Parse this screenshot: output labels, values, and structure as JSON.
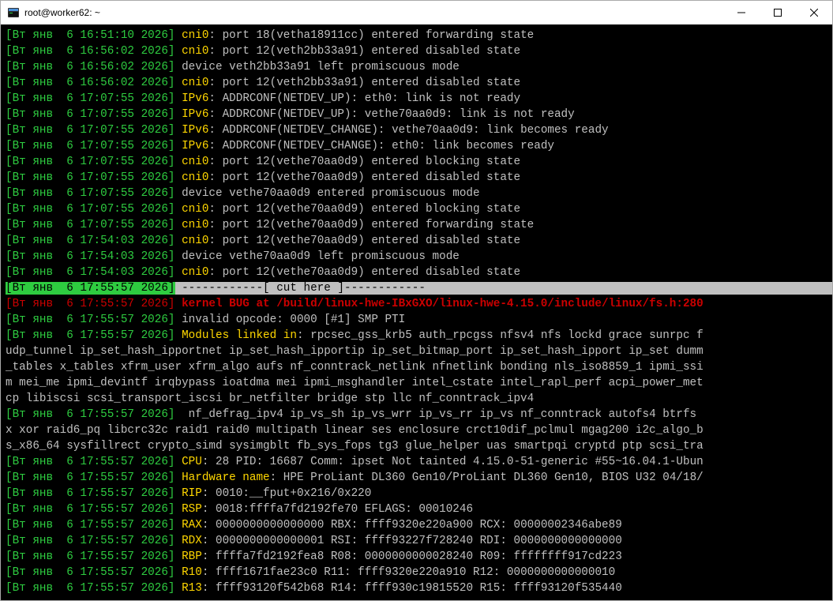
{
  "window": {
    "title": "root@worker62: ~"
  },
  "lines": [
    {
      "kind": "log",
      "ts": "[Вт янв  6 16:51:10 2026]",
      "src": "cni0",
      "msg": ": port 18(vetha18911cc) entered forwarding state"
    },
    {
      "kind": "log",
      "ts": "[Вт янв  6 16:56:02 2026]",
      "src": "cni0",
      "msg": ": port 12(veth2bb33a91) entered disabled state"
    },
    {
      "kind": "log",
      "ts": "[Вт янв  6 16:56:02 2026]",
      "src": "",
      "msg": "device veth2bb33a91 left promiscuous mode"
    },
    {
      "kind": "log",
      "ts": "[Вт янв  6 16:56:02 2026]",
      "src": "cni0",
      "msg": ": port 12(veth2bb33a91) entered disabled state"
    },
    {
      "kind": "log",
      "ts": "[Вт янв  6 17:07:55 2026]",
      "src": "IPv6",
      "msg": ": ADDRCONF(NETDEV_UP): eth0: link is not ready"
    },
    {
      "kind": "log",
      "ts": "[Вт янв  6 17:07:55 2026]",
      "src": "IPv6",
      "msg": ": ADDRCONF(NETDEV_UP): vethe70aa0d9: link is not ready"
    },
    {
      "kind": "log",
      "ts": "[Вт янв  6 17:07:55 2026]",
      "src": "IPv6",
      "msg": ": ADDRCONF(NETDEV_CHANGE): vethe70aa0d9: link becomes ready"
    },
    {
      "kind": "log",
      "ts": "[Вт янв  6 17:07:55 2026]",
      "src": "IPv6",
      "msg": ": ADDRCONF(NETDEV_CHANGE): eth0: link becomes ready"
    },
    {
      "kind": "log",
      "ts": "[Вт янв  6 17:07:55 2026]",
      "src": "cni0",
      "msg": ": port 12(vethe70aa0d9) entered blocking state"
    },
    {
      "kind": "log",
      "ts": "[Вт янв  6 17:07:55 2026]",
      "src": "cni0",
      "msg": ": port 12(vethe70aa0d9) entered disabled state"
    },
    {
      "kind": "log",
      "ts": "[Вт янв  6 17:07:55 2026]",
      "src": "",
      "msg": "device vethe70aa0d9 entered promiscuous mode"
    },
    {
      "kind": "log",
      "ts": "[Вт янв  6 17:07:55 2026]",
      "src": "cni0",
      "msg": ": port 12(vethe70aa0d9) entered blocking state"
    },
    {
      "kind": "log",
      "ts": "[Вт янв  6 17:07:55 2026]",
      "src": "cni0",
      "msg": ": port 12(vethe70aa0d9) entered forwarding state"
    },
    {
      "kind": "log",
      "ts": "[Вт янв  6 17:54:03 2026]",
      "src": "cni0",
      "msg": ": port 12(vethe70aa0d9) entered disabled state"
    },
    {
      "kind": "log",
      "ts": "[Вт янв  6 17:54:03 2026]",
      "src": "",
      "msg": "device vethe70aa0d9 left promiscuous mode"
    },
    {
      "kind": "log",
      "ts": "[Вт янв  6 17:54:03 2026]",
      "src": "cni0",
      "msg": ": port 12(vethe70aa0d9) entered disabled state"
    },
    {
      "kind": "cut",
      "ts": "[Вт янв  6 17:55:57 2026]",
      "msg": " ------------[ cut here ]------------"
    },
    {
      "kind": "bug",
      "ts": "[Вт янв  6 17:55:57 2026]",
      "msg": " kernel BUG at /build/linux-hwe-IBxGXO/linux-hwe-4.15.0/include/linux/fs.h:280"
    },
    {
      "kind": "log",
      "ts": "[Вт янв  6 17:55:57 2026]",
      "src": "",
      "msg": "invalid opcode: 0000 [#1] SMP PTI"
    },
    {
      "kind": "mods-start",
      "ts": "[Вт янв  6 17:55:57 2026]",
      "src": "Modules linked in",
      "msg": ": rpcsec_gss_krb5 auth_rpcgss nfsv4 nfs lockd grace sunrpc f"
    },
    {
      "kind": "wrap",
      "msg": "udp_tunnel ip_set_hash_ipportnet ip_set_hash_ipportip ip_set_bitmap_port ip_set_hash_ipport ip_set dumm"
    },
    {
      "kind": "wrap",
      "msg": "_tables x_tables xfrm_user xfrm_algo aufs nf_conntrack_netlink nfnetlink bonding nls_iso8859_1 ipmi_ssi"
    },
    {
      "kind": "wrap",
      "msg": "m mei_me ipmi_devintf irqbypass ioatdma mei ipmi_msghandler intel_cstate intel_rapl_perf acpi_power_met"
    },
    {
      "kind": "wrap",
      "msg": "cp libiscsi scsi_transport_iscsi br_netfilter bridge stp llc nf_conntrack_ipv4"
    },
    {
      "kind": "log",
      "ts": "[Вт янв  6 17:55:57 2026]",
      "src": "",
      "msg": " nf_defrag_ipv4 ip_vs_sh ip_vs_wrr ip_vs_rr ip_vs nf_conntrack autofs4 btrfs"
    },
    {
      "kind": "wrap",
      "msg": "x xor raid6_pq libcrc32c raid1 raid0 multipath linear ses enclosure crct10dif_pclmul mgag200 i2c_algo_b"
    },
    {
      "kind": "wrap",
      "msg": "s_x86_64 sysfillrect crypto_simd sysimgblt fb_sys_fops tg3 glue_helper uas smartpqi cryptd ptp scsi_tra"
    },
    {
      "kind": "log",
      "ts": "[Вт янв  6 17:55:57 2026]",
      "src": "CPU",
      "msg": ": 28 PID: 16687 Comm: ipset Not tainted 4.15.0-51-generic #55~16.04.1-Ubun"
    },
    {
      "kind": "log",
      "ts": "[Вт янв  6 17:55:57 2026]",
      "src": "Hardware name",
      "msg": ": HPE ProLiant DL360 Gen10/ProLiant DL360 Gen10, BIOS U32 04/18/"
    },
    {
      "kind": "log",
      "ts": "[Вт янв  6 17:55:57 2026]",
      "src": "RIP",
      "msg": ": 0010:__fput+0x216/0x220"
    },
    {
      "kind": "log",
      "ts": "[Вт янв  6 17:55:57 2026]",
      "src": "RSP",
      "msg": ": 0018:ffffa7fd2192fe70 EFLAGS: 00010246"
    },
    {
      "kind": "log",
      "ts": "[Вт янв  6 17:55:57 2026]",
      "src": "RAX",
      "msg": ": 0000000000000000 RBX: ffff9320e220a900 RCX: 00000002346abe89"
    },
    {
      "kind": "log",
      "ts": "[Вт янв  6 17:55:57 2026]",
      "src": "RDX",
      "msg": ": 0000000000000001 RSI: ffff93227f728240 RDI: 0000000000000000"
    },
    {
      "kind": "log",
      "ts": "[Вт янв  6 17:55:57 2026]",
      "src": "RBP",
      "msg": ": ffffa7fd2192fea8 R08: 0000000000028240 R09: ffffffff917cd223"
    },
    {
      "kind": "log",
      "ts": "[Вт янв  6 17:55:57 2026]",
      "src": "R10",
      "msg": ": ffff1671fae23c0 R11: ffff9320e220a910 R12: 0000000000000010"
    },
    {
      "kind": "log",
      "ts": "[Вт янв  6 17:55:57 2026]",
      "src": "R13",
      "msg": ": ffff93120f542b68 R14: ffff930c19815520 R15: ffff93120f535440"
    }
  ]
}
